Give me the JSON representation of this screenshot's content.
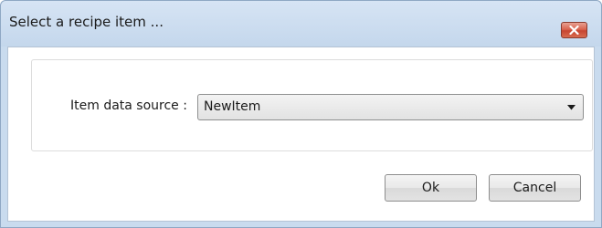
{
  "window": {
    "title": "Select a recipe item ...",
    "close_icon": "close-icon"
  },
  "form": {
    "item_source_label": "Item data source :",
    "item_source_value": "NewItem",
    "dropdown_icon": "dropdown-arrow-icon"
  },
  "buttons": {
    "ok_label": "Ok",
    "cancel_label": "Cancel"
  },
  "colors": {
    "titlebar": "#c9dbee",
    "close_button": "#d9644f"
  }
}
